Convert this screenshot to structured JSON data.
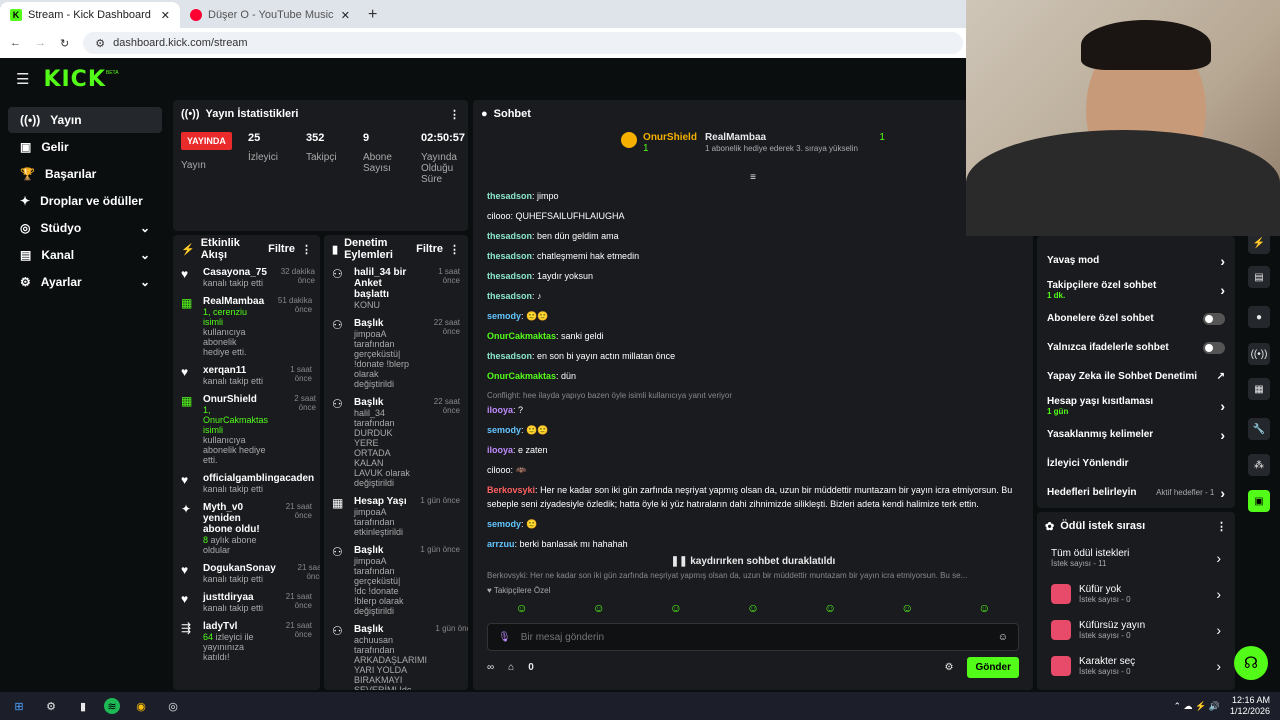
{
  "browser": {
    "tab1": "Stream - Kick Dashboard",
    "tab2": "Düşer O - YouTube Music",
    "url": "dashboard.kick.com/stream"
  },
  "brand": {
    "logo": "KICK",
    "beta": "BETA",
    "accent": "#53fc18"
  },
  "sidebar": {
    "items": [
      {
        "label": "Yayın",
        "icon": "broadcast-icon"
      },
      {
        "label": "Gelir",
        "icon": "money-icon"
      },
      {
        "label": "Başarılar",
        "icon": "trophy-icon"
      },
      {
        "label": "Droplar ve ödüller",
        "icon": "gift-icon"
      },
      {
        "label": "Stüdyo",
        "icon": "studio-icon"
      },
      {
        "label": "Kanal",
        "icon": "channel-icon"
      },
      {
        "label": "Ayarlar",
        "icon": "gear-icon"
      }
    ]
  },
  "stats": {
    "title": "Yayın İstatistikleri",
    "live": "YAYINDA",
    "live_label": "Yayın",
    "viewers": "25",
    "viewers_label": "İzleyici",
    "followers": "352",
    "followers_label": "Takipçi",
    "subs": "9",
    "subs_label": "Abone Sayısı",
    "uptime": "02:50:57",
    "uptime_label": "Yayında Olduğu Süre"
  },
  "activity": {
    "title": "Etkinlik Akışı",
    "filter": "Filtre",
    "items": [
      {
        "name": "Casayona_75",
        "time": "32 dakika önce",
        "desc": "kanalı takip etti",
        "hl": ""
      },
      {
        "name": "RealMambaa",
        "time": "51 dakika önce",
        "desc": "kullanıcıya abonelik hediye etti.",
        "hl": "1, cerenziu isimli"
      },
      {
        "name": "xerqan11",
        "time": "1 saat önce",
        "desc": "kanalı takip etti",
        "hl": ""
      },
      {
        "name": "OnurShield",
        "time": "2 saat önce",
        "desc": "kullanıcıya abonelik hediye etti.",
        "hl": "1, OnurCakmaktas isimli"
      },
      {
        "name": "officialgamblingacaden",
        "time": "",
        "desc": "kanalı takip etti",
        "hl": ""
      },
      {
        "name": "Myth_v0 yeniden abone oldu!",
        "time": "21 saat önce",
        "desc": "aylık abone oldular",
        "hl": "8"
      },
      {
        "name": "DogukanSonay",
        "time": "21 saat önce",
        "desc": "kanalı takip etti",
        "hl": ""
      },
      {
        "name": "justtdiryaa",
        "time": "21 saat önce",
        "desc": "kanalı takip etti",
        "hl": ""
      },
      {
        "name": "ladyTvl",
        "time": "21 saat önce",
        "desc": "izleyici ile yayınınıza katıldı!",
        "hl": "64"
      }
    ]
  },
  "mod": {
    "title": "Denetim Eylemleri",
    "filter": "Filtre",
    "items": [
      {
        "title": "halil_34 bir Anket başlattı",
        "time": "1 saat önce",
        "desc": "KONU"
      },
      {
        "title": "Başlık",
        "time": "22 saat önce",
        "desc": "jimpoaA tarafından gerçeküstü| !donate !blerp olarak değiştirildi"
      },
      {
        "title": "Başlık",
        "time": "22 saat önce",
        "desc": "halil_34 tarafından DURDUK YERE ORTADA KALAN LAVUK olarak değiştirildi"
      },
      {
        "title": "Hesap Yaşı",
        "time": "1 gün önce",
        "desc": "jimpoaA tarafından etkinleştirildi"
      },
      {
        "title": "Başlık",
        "time": "1 gün önce",
        "desc": "jimpoaA tarafından gerçeküstü| !dc !donate !blerp olarak değiştirildi"
      },
      {
        "title": "Başlık",
        "time": "1 gün önce",
        "desc": "achuusan tarafından ARKADAŞLARIMI YARI YOLDA BIRAKMAYI SEVERİM| !dc !donate !blerp olarak değiştirildi"
      }
    ]
  },
  "chat": {
    "title": "Sohbet",
    "pin1_name": "OnurShield",
    "pin1_count": "1",
    "pin2_name": "RealMambaa",
    "pin2_count": "1",
    "pin2_desc": "1 abonelik hediye ederek 3. sıraya yükselin",
    "lines": [
      {
        "u": "thesadson",
        "c": "u1",
        "t": "jimpo"
      },
      {
        "u": "cilooo",
        "c": "u2",
        "t": "QUHEFSAILUFHLAIUGHA"
      },
      {
        "u": "thesadson",
        "c": "u1",
        "t": "ben dün geldim ama"
      },
      {
        "u": "thesadson",
        "c": "u1",
        "t": "chatleşmemi hak etmedin"
      },
      {
        "u": "thesadson",
        "c": "u1",
        "t": "1aydır yoksun"
      },
      {
        "u": "thesadson",
        "c": "u1",
        "t": "♪"
      },
      {
        "u": "semody",
        "c": "u6",
        "t": "🙂🙂"
      },
      {
        "u": "OnurCakmaktas",
        "c": "u3",
        "t": "sanki geldi"
      },
      {
        "u": "thesadson",
        "c": "u1",
        "t": "en son bi yayın actın millatan önce"
      },
      {
        "u": "OnurCakmaktas",
        "c": "u3",
        "t": "dün"
      },
      {
        "u": "ilooya",
        "c": "u5",
        "t": "?",
        "reply": "Conflight: hee ilayda yapıyo bazen öyle isimli kullanıcıya yanıt veriyor"
      },
      {
        "u": "semody",
        "c": "u6",
        "t": "🙂🙂"
      },
      {
        "u": "ilooya",
        "c": "u5",
        "t": "e zaten"
      },
      {
        "u": "cilooo",
        "c": "u2",
        "t": "🦇"
      },
      {
        "u": "Berkovsyki",
        "c": "u4",
        "t": "Her ne kadar son iki gün zarfında neşriyat yapmış olsan da, uzun bir müddettir muntazam bir yayın icra etmiyorsun. Bu sebeple seni ziyadesiyle özledik; hatta öyle ki yüz hatıraların dahi zihnimizde silikleşti. Bizleri adeta kendi halimize terk ettin."
      },
      {
        "u": "semody",
        "c": "u6",
        "t": "🙂"
      },
      {
        "u": "arrzuu",
        "c": "u6",
        "t": "berki banlasak mı hahahah"
      },
      {
        "u": "Berkovsyki",
        "c": "u4",
        "t": "😄"
      }
    ],
    "paused": "kaydırırken sohbet duraklatıldı",
    "reply_preview": "Berkovsyki: Her ne kadar son iki gün zarfında neşriyat yapmış olsan da, uzun bir müddettir muntazam bir yayın icra etmiyorsun. Bu se...",
    "followers_only": "Takipçilere Özel",
    "placeholder": "Bir mesaj gönderin",
    "points": "0",
    "send": "Gönder"
  },
  "settings": {
    "items": [
      {
        "label": "Yavaş mod",
        "sub": "",
        "type": "arrow"
      },
      {
        "label": "Takipçilere özel sohbet",
        "sub": "1 dk.",
        "type": "arrow"
      },
      {
        "label": "Abonelere özel sohbet",
        "sub": "",
        "type": "toggle"
      },
      {
        "label": "Yalnızca ifadelerle sohbet",
        "sub": "",
        "type": "toggle"
      },
      {
        "label": "Yapay Zeka ile Sohbet Denetimi",
        "sub": "",
        "type": "ext"
      },
      {
        "label": "Hesap yaşı kısıtlaması",
        "sub": "1 gün",
        "type": "arrow"
      },
      {
        "label": "Yasaklanmış kelimeler",
        "sub": "",
        "type": "arrow"
      },
      {
        "label": "İzleyici Yönlendir",
        "sub": "",
        "type": "none"
      },
      {
        "label": "Hedefleri belirleyin",
        "sub": "",
        "type": "arrow",
        "extra": "Aktif hedefler - 1"
      }
    ]
  },
  "rewards": {
    "title": "Ödül istek sırası",
    "items": [
      {
        "name": "Tüm ödül istekleri",
        "sub": "İstek sayısı - 11"
      },
      {
        "name": "Küfür yok",
        "sub": "İstek sayısı - 0"
      },
      {
        "name": "Küfürsüz yayın",
        "sub": "İstek sayısı - 0"
      },
      {
        "name": "Karakter seç",
        "sub": "İstek sayısı - 0"
      }
    ]
  },
  "taskbar": {
    "time": "12:16 AM",
    "date": "1/12/2026"
  }
}
